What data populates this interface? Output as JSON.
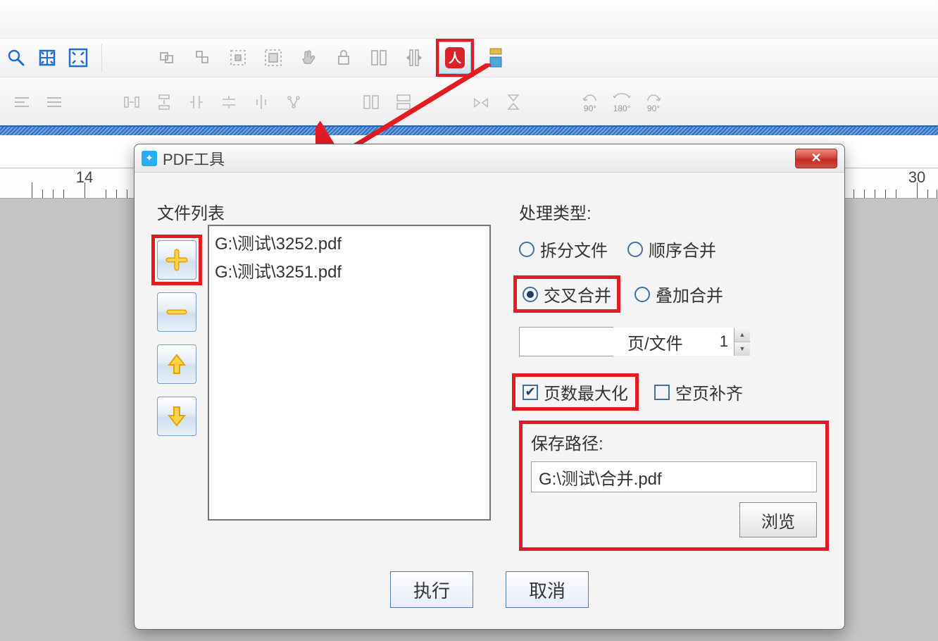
{
  "toolbar": {
    "highlight": "pdf-tool"
  },
  "ruler": {
    "left_label": "14",
    "right_label": "30"
  },
  "dialog": {
    "title": "PDF工具",
    "file_list": {
      "label": "文件列表",
      "items": [
        "G:\\测试\\3252.pdf",
        "G:\\测试\\3251.pdf"
      ]
    },
    "process_type": {
      "label": "处理类型:",
      "options": {
        "split": "拆分文件",
        "seq_merge": "顺序合并",
        "cross_merge": "交叉合并",
        "overlay_merge": "叠加合并"
      },
      "selected": "cross_merge"
    },
    "pages_per_file": {
      "value": "1",
      "unit": "页/文件"
    },
    "maximize_pages": {
      "label": "页数最大化",
      "checked": true
    },
    "pad_blank": {
      "label": "空页补齐",
      "checked": false
    },
    "save": {
      "label": "保存路径:",
      "path": "G:\\测试\\合并.pdf",
      "browse": "浏览"
    },
    "buttons": {
      "execute": "执行",
      "cancel": "取消"
    }
  }
}
